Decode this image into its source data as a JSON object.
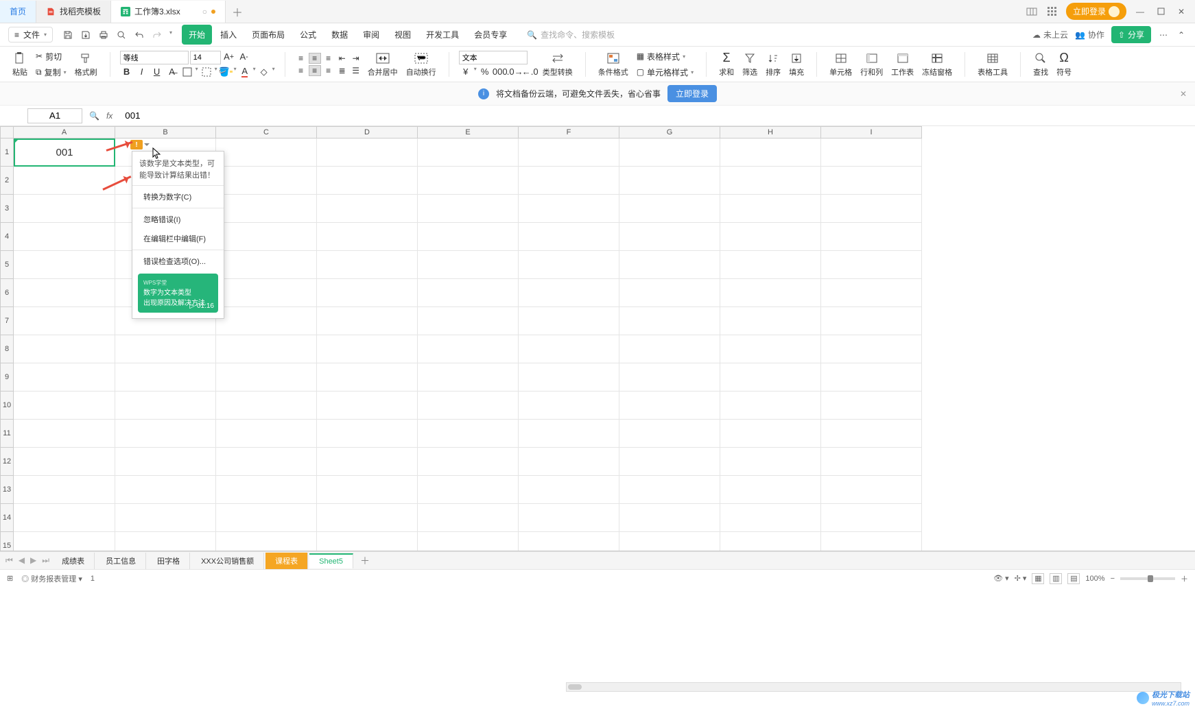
{
  "tabs": {
    "home": "首页",
    "template": "找稻壳模板",
    "active": "工作簿3.xlsx"
  },
  "titlebar": {
    "login": "立即登录"
  },
  "menu": {
    "file": "文件",
    "items": [
      "开始",
      "插入",
      "页面布局",
      "公式",
      "数据",
      "审阅",
      "视图",
      "开发工具",
      "会员专享"
    ],
    "search_placeholder": "查找命令、搜索模板",
    "cloud": "未上云",
    "collab": "协作",
    "share": "分享"
  },
  "ribbon": {
    "paste": "粘贴",
    "cut": "剪切",
    "copy": "复制",
    "format_painter": "格式刷",
    "font": "等线",
    "font_size": "14",
    "merge_center": "合并居中",
    "auto_wrap": "自动换行",
    "number_format": "文本",
    "type_convert": "类型转换",
    "cond_format": "条件格式",
    "table_style": "表格样式",
    "cell_style": "单元格样式",
    "sum": "求和",
    "filter": "筛选",
    "sort": "排序",
    "fill": "填充",
    "cell": "单元格",
    "row_col": "行和列",
    "worksheet": "工作表",
    "freeze": "冻结窗格",
    "table_tools": "表格工具",
    "find": "查找",
    "symbol": "符号"
  },
  "notify": {
    "text": "将文档备份云端，可避免文件丢失，省心省事",
    "btn": "立即登录"
  },
  "formula": {
    "cell_ref": "A1",
    "fx": "fx",
    "value": "001"
  },
  "columns": [
    "A",
    "B",
    "C",
    "D",
    "E",
    "F",
    "G",
    "H",
    "I"
  ],
  "rows": [
    "1",
    "2",
    "3",
    "4",
    "5",
    "6",
    "7",
    "8",
    "9",
    "10",
    "11",
    "12",
    "13",
    "14",
    "15"
  ],
  "cell_a1": "001",
  "popup": {
    "msg": "该数字是文本类型，可能导致计算结果出错！",
    "convert": "转换为数字(C)",
    "ignore": "忽略错误(I)",
    "edit": "在编辑栏中编辑(F)",
    "options": "错误检查选项(O)...",
    "video_tag": "WPS学堂",
    "video_line1": "数字为文本类型",
    "video_line2": "出现原因及解决方法",
    "duration": "01:16"
  },
  "sheets": [
    "成绩表",
    "员工信息",
    "田字格",
    "XXX公司销售额",
    "课程表",
    "Sheet5"
  ],
  "status": {
    "template": "财务报表管理",
    "page": "1",
    "zoom": "100%"
  },
  "watermark": {
    "name": "极光下载站",
    "url": "www.xz7.com"
  }
}
